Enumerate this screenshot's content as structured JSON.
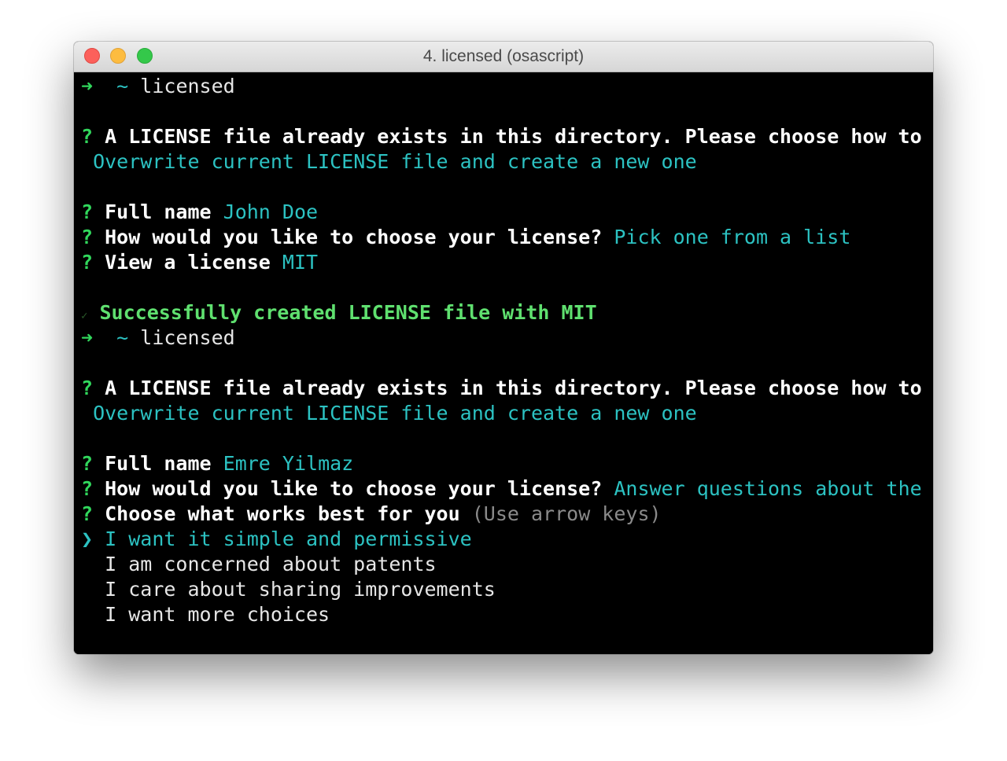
{
  "window": {
    "title": "4. licensed (osascript)"
  },
  "colors": {
    "prompt_green": "#31d75c",
    "answer_cyan": "#2cc2c2",
    "hint_grey": "#8a8a8a",
    "success_green": "#5fe06f",
    "background": "#000000"
  },
  "terminal": {
    "prompt_arrow": "➜",
    "prompt_tilde": "~",
    "command": "licensed",
    "question_mark": "?",
    "pointer": "❯",
    "run1": {
      "q1": "A LICENSE file already exists in this directory. Please choose how to proceed:",
      "a1": "Overwrite current LICENSE file and create a new one",
      "q2": "Full name",
      "a2": "John Doe",
      "q3": "How would you like to choose your license?",
      "a3": "Pick one from a list",
      "q4": "View a license",
      "a4": "MIT",
      "success_mark": "✓",
      "success": "Successfully created LICENSE file with MIT"
    },
    "run2": {
      "q1": "A LICENSE file already exists in this directory. Please choose how to proceed:",
      "a1": "Overwrite current LICENSE file and create a new one",
      "q2": "Full name",
      "a2": "Emre Yilmaz",
      "q3": "How would you like to choose your license?",
      "a3": "Answer questions about the license",
      "q4": "Choose what works best for you",
      "hint": "(Use arrow keys)",
      "options": [
        "I want it simple and permissive",
        "I am concerned about patents",
        "I care about sharing improvements",
        "I want more choices"
      ]
    }
  }
}
